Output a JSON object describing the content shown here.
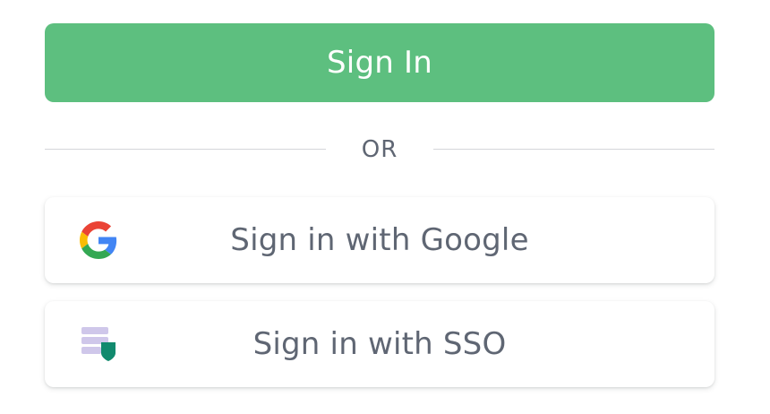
{
  "primary": {
    "label": "Sign In",
    "color": "#5dbf7f"
  },
  "divider": {
    "text": "OR"
  },
  "providers": [
    {
      "label": "Sign in with Google",
      "icon": "google-icon"
    },
    {
      "label": "Sign in with SSO",
      "icon": "sso-icon"
    }
  ],
  "colors": {
    "label_text": "#5f6673",
    "divider_line": "#d4d6da",
    "sso_icon_primary": "#cfc7ea",
    "sso_icon_accent": "#128a6e"
  }
}
